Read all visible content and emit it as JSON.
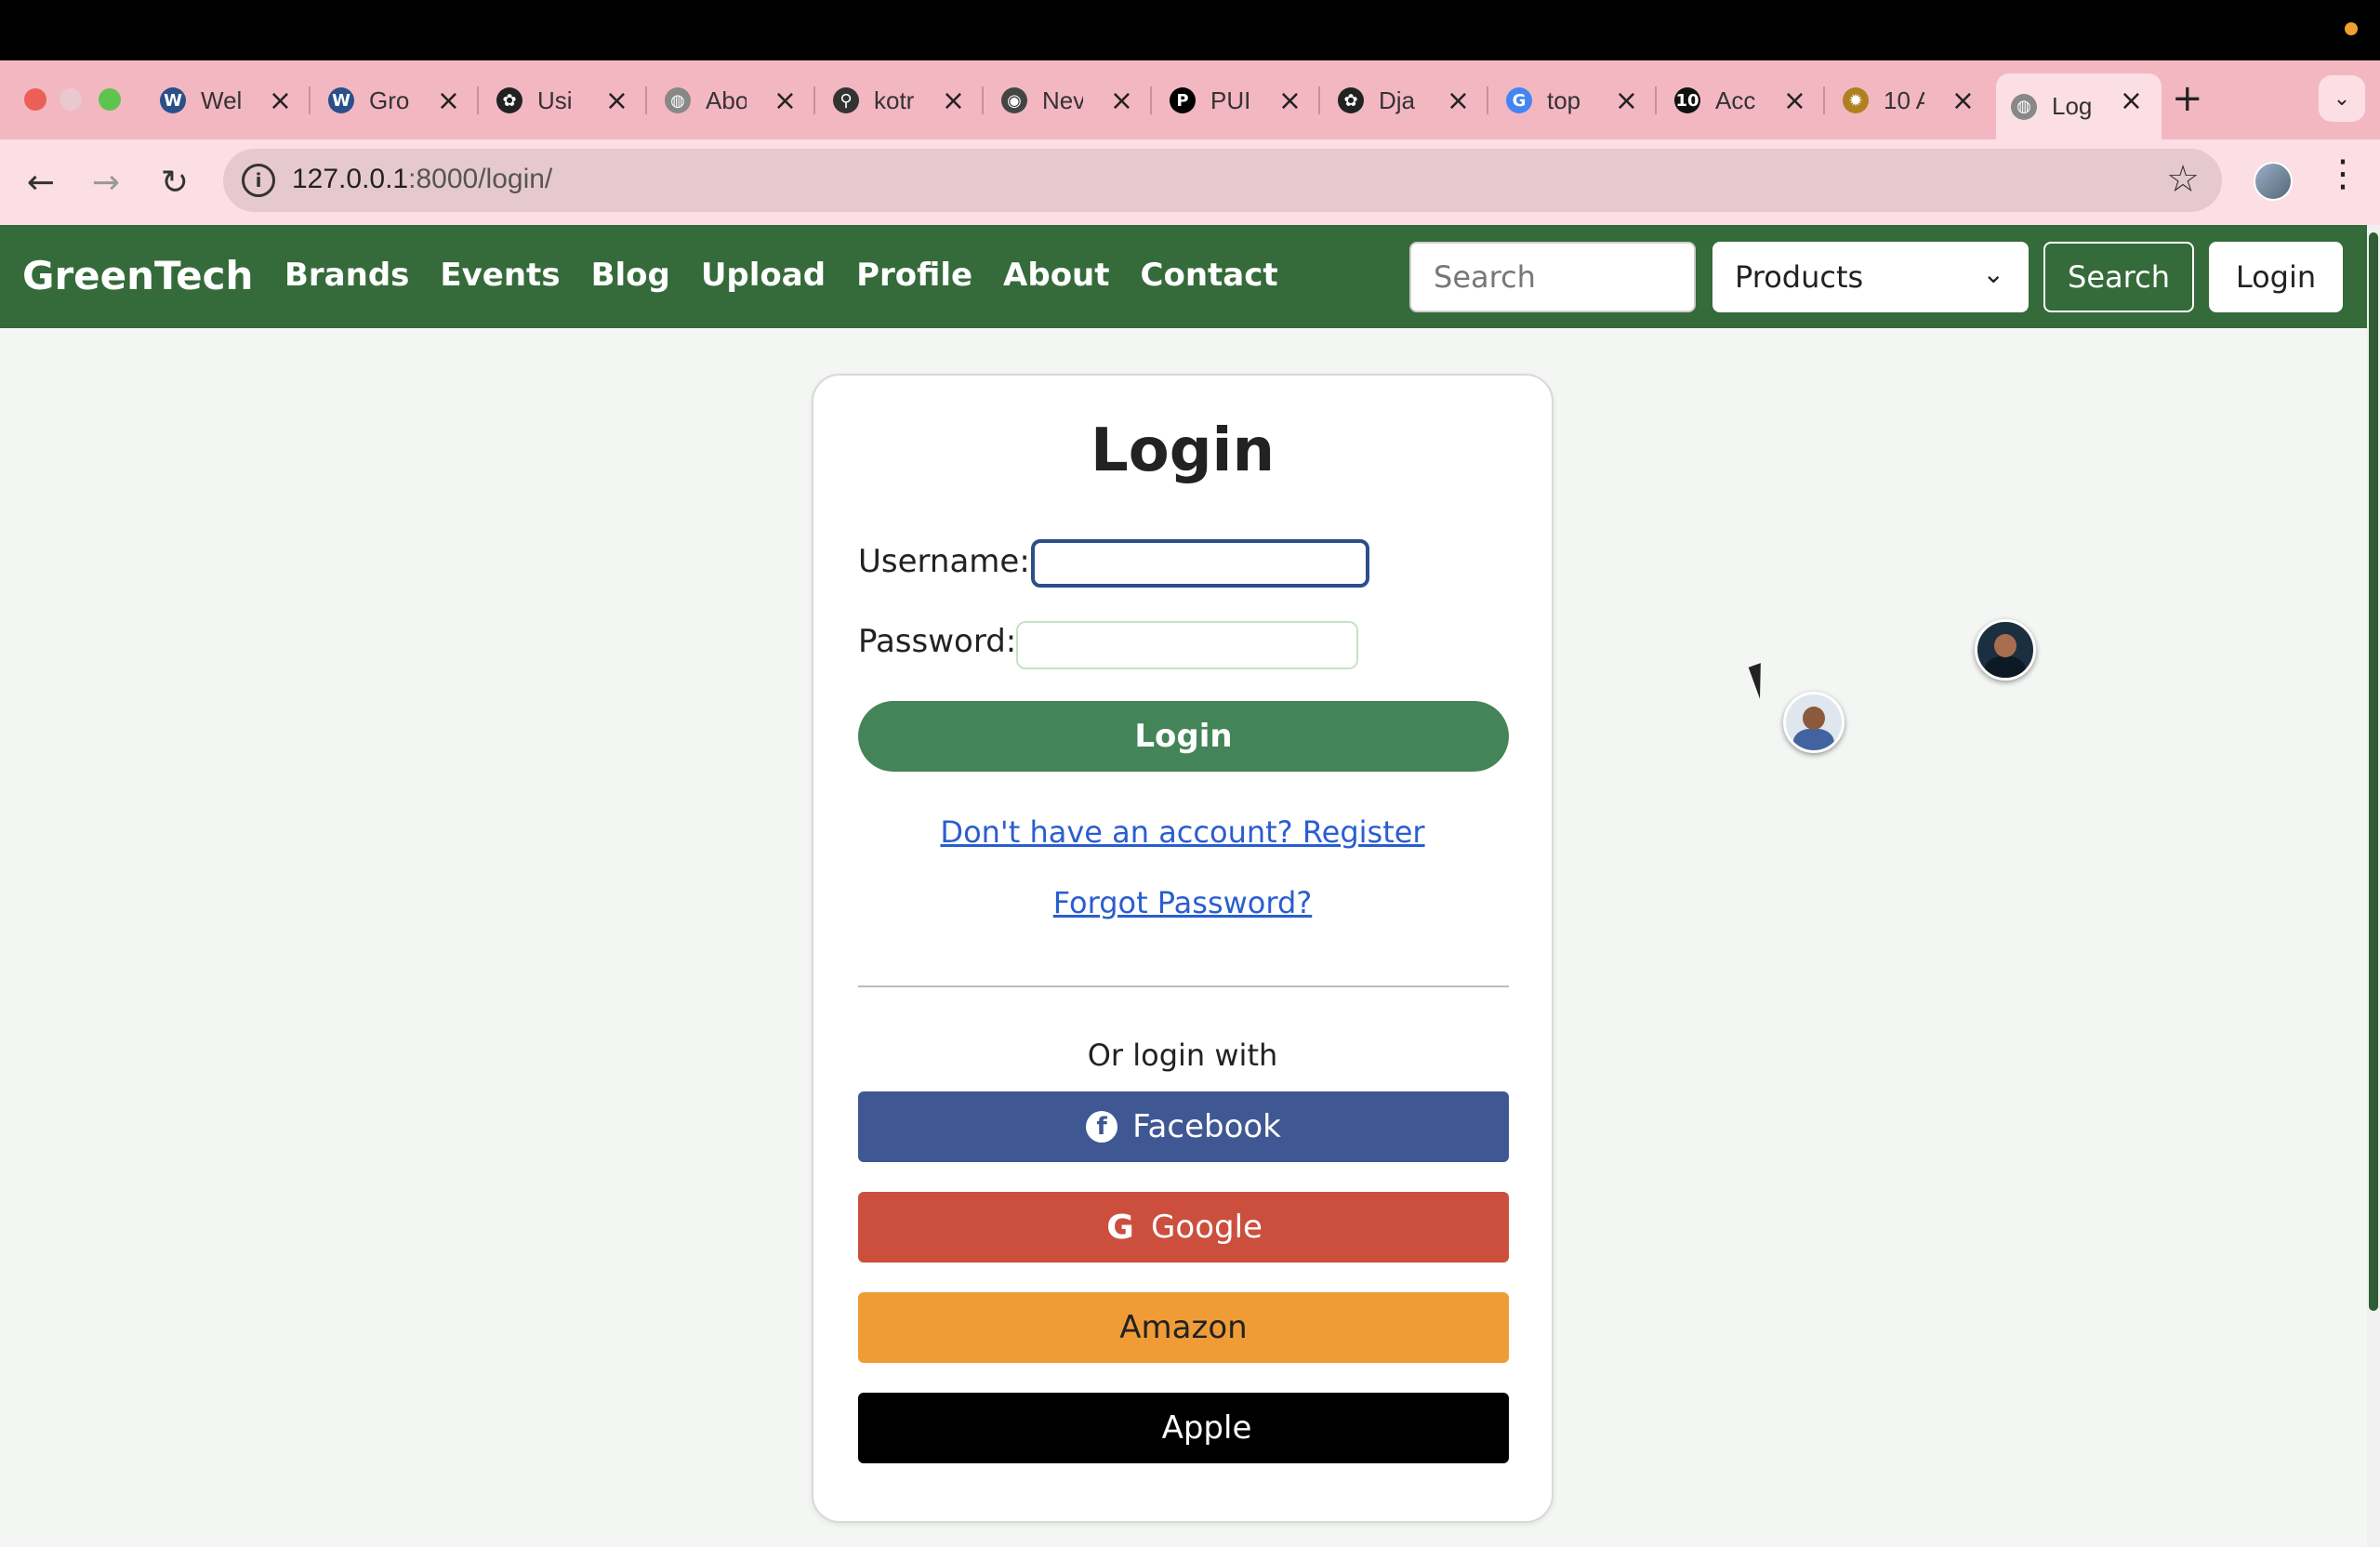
{
  "browser": {
    "tabs": [
      {
        "label": "Wel",
        "favicon": "wp-icon",
        "color": "#2a4f8a",
        "glyph": "W"
      },
      {
        "label": "Gro",
        "favicon": "wp-icon",
        "color": "#2a4f8a",
        "glyph": "W"
      },
      {
        "label": "Usi",
        "favicon": "openai-icon",
        "color": "#222222",
        "glyph": "✿"
      },
      {
        "label": "Abo",
        "favicon": "globe-icon",
        "color": "#888888",
        "glyph": "◍"
      },
      {
        "label": "kotr",
        "favicon": "search-icon",
        "color": "#333333",
        "glyph": "⚲"
      },
      {
        "label": "Nev",
        "favicon": "chrome-icon",
        "color": "#444444",
        "glyph": "◉"
      },
      {
        "label": "PUI",
        "favicon": "puma-icon",
        "color": "#000000",
        "glyph": "P"
      },
      {
        "label": "Dja",
        "favicon": "openai-icon",
        "color": "#222222",
        "glyph": "✿"
      },
      {
        "label": "top",
        "favicon": "google-icon",
        "color": "#4285f4",
        "glyph": "G"
      },
      {
        "label": "Acc",
        "favicon": "10-icon",
        "color": "#111111",
        "glyph": "10"
      },
      {
        "label": "10 A",
        "favicon": "gear-icon",
        "color": "#b08020",
        "glyph": "✹"
      },
      {
        "label": "Log",
        "favicon": "globe-icon",
        "color": "#888888",
        "glyph": "◍"
      }
    ],
    "url_host": "127.0.0.1",
    "url_path": ":8000/login/"
  },
  "navbar": {
    "brand": "GreenTech",
    "links": [
      "Brands",
      "Events",
      "Blog",
      "Upload",
      "Profile",
      "About",
      "Contact"
    ],
    "search_placeholder": "Search",
    "select_value": "Products",
    "search_button": "Search",
    "login_button": "Login"
  },
  "login": {
    "title": "Login",
    "username_label": "Username:",
    "password_label": "Password:",
    "submit": "Login",
    "register_link": "Don't have an account? Register",
    "forgot_link": "Forgot Password?",
    "or_text": "Or login with",
    "social": {
      "facebook": "Facebook",
      "google": "Google",
      "amazon": "Amazon",
      "apple": "Apple"
    }
  },
  "colors": {
    "navbar": "#356a3a",
    "login_button": "#438558",
    "facebook": "#3f5893",
    "google": "#cc4f3d",
    "amazon": "#f09c36",
    "apple": "#000000",
    "tabstrip": "#f3b7c2"
  }
}
